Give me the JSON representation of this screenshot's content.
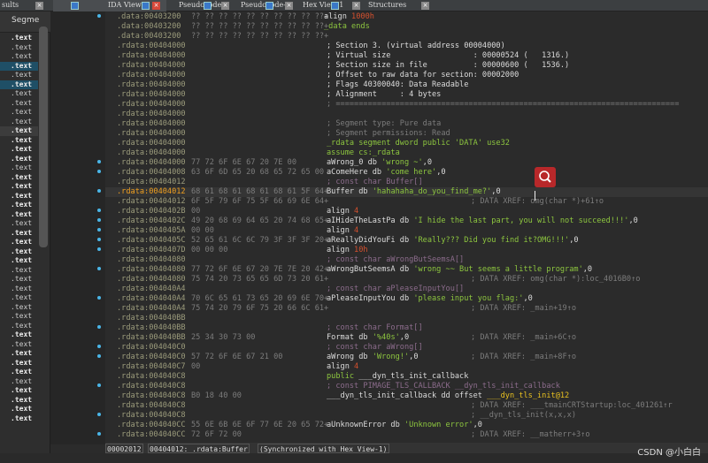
{
  "tabs": [
    {
      "label": "sults",
      "icon": "none",
      "active": false
    },
    {
      "label": "IDA View-A",
      "icon": "disassembly-icon",
      "active": true
    },
    {
      "label": "Pseudocode-B",
      "icon": "pseudocode-icon",
      "active": false
    },
    {
      "label": "Pseudocode-A",
      "icon": "pseudocode-icon",
      "active": false
    },
    {
      "label": "Hex View-1",
      "icon": "hex-icon",
      "active": false
    },
    {
      "label": "Structures",
      "icon": "structures-icon",
      "active": false
    }
  ],
  "segments_panel": {
    "header": "Segme",
    "rows": [
      {
        "t": ".text",
        "b": 1
      },
      {
        "t": ".text"
      },
      {
        "t": ".text"
      },
      {
        "t": ".text",
        "b": 1,
        "hl": 1
      },
      {
        "t": ".text"
      },
      {
        "t": ".text",
        "b": 1,
        "hl": 1
      },
      {
        "t": ".text"
      },
      {
        "t": ".text"
      },
      {
        "t": ".text"
      },
      {
        "t": ".text"
      },
      {
        "t": ".text",
        "b": 1,
        "gr": 1
      },
      {
        "t": ".text",
        "b": 1
      },
      {
        "t": ".text",
        "b": 1
      },
      {
        "t": ".text",
        "b": 1
      },
      {
        "t": ".text"
      },
      {
        "t": ".text",
        "b": 1
      },
      {
        "t": ".text",
        "b": 1
      },
      {
        "t": ".text",
        "b": 1
      },
      {
        "t": ".text",
        "b": 1
      },
      {
        "t": ".text",
        "b": 1
      },
      {
        "t": ".text"
      },
      {
        "t": ".text",
        "b": 1
      },
      {
        "t": ".text",
        "b": 1
      },
      {
        "t": ".text",
        "b": 1
      },
      {
        "t": ".text",
        "b": 1
      },
      {
        "t": ".text"
      },
      {
        "t": ".text"
      },
      {
        "t": ".text"
      },
      {
        "t": ".text"
      },
      {
        "t": ".text"
      },
      {
        "t": ".text"
      },
      {
        "t": ".text"
      },
      {
        "t": ".text",
        "b": 1
      },
      {
        "t": ".text"
      },
      {
        "t": ".text",
        "b": 1
      },
      {
        "t": ".text",
        "b": 1
      },
      {
        "t": ".text",
        "b": 1
      },
      {
        "t": ".text"
      },
      {
        "t": ".text",
        "b": 1
      },
      {
        "t": ".text",
        "b": 1
      },
      {
        "t": ".text",
        "b": 1
      },
      {
        "t": ".text",
        "b": 1
      }
    ]
  },
  "listing": [
    {
      "a": ".data:00403200",
      "h": "?? ?? ?? ?? ?? ?? ?? ?? ?? ??+",
      "p": [
        [
          "align ",
          "w"
        ],
        [
          "1000h",
          "o"
        ]
      ],
      "shift": -3
    },
    {
      "a": ".data:00403200",
      "h": "?? ?? ?? ?? ?? ?? ?? ?? ?? ??+",
      "p": [
        [
          "_data ends",
          "g"
        ]
      ],
      "shift": -3
    },
    {
      "a": ".data:00403200",
      "h": "?? ?? ?? ?? ?? ?? ?? ?? ?? ??+",
      "p": []
    },
    {
      "a": ".rdata:00404000",
      "h": "",
      "p": [
        [
          "; Section 3. (virtual address 00004000)",
          "w"
        ]
      ]
    },
    {
      "a": ".rdata:00404000",
      "h": "",
      "p": [
        [
          "; Virtual size                  : 00000524 (   1316.)",
          "w"
        ]
      ]
    },
    {
      "a": ".rdata:00404000",
      "h": "",
      "p": [
        [
          "; Section size in file          : 00000600 (   1536.)",
          "w"
        ]
      ]
    },
    {
      "a": ".rdata:00404000",
      "h": "",
      "p": [
        [
          "; Offset to raw data for section: 00002000",
          "w"
        ]
      ]
    },
    {
      "a": ".rdata:00404000",
      "h": "",
      "p": [
        [
          "; Flags 40300040: Data Readable",
          "w"
        ]
      ]
    },
    {
      "a": ".rdata:00404000",
      "h": "",
      "p": [
        [
          "; Alignment     : 4 bytes",
          "w"
        ]
      ]
    },
    {
      "a": ".rdata:00404000",
      "h": "",
      "p": [
        [
          "; ===========================================================================",
          "c"
        ]
      ]
    },
    {
      "a": ".rdata:00404000",
      "h": "",
      "p": []
    },
    {
      "a": ".rdata:00404000",
      "h": "",
      "p": [
        [
          "; Segment type: Pure data",
          "c"
        ]
      ]
    },
    {
      "a": ".rdata:00404000",
      "h": "",
      "p": [
        [
          "; Segment permissions: Read",
          "c"
        ]
      ]
    },
    {
      "a": ".rdata:00404000",
      "h": "",
      "p": [
        [
          "_rdata segment dword public 'DATA' use32",
          "g"
        ]
      ]
    },
    {
      "a": ".rdata:00404000",
      "h": "",
      "p": [
        [
          "assume cs:_rdata",
          "g"
        ]
      ]
    },
    {
      "a": ".rdata:00404000",
      "h": "77 72 6F 6E 67 20 7E 00",
      "p": [
        [
          "aWrong_0 db ",
          "w"
        ],
        [
          "'wrong ~'",
          "g"
        ],
        [
          ",0",
          "w"
        ]
      ]
    },
    {
      "a": ".rdata:00404008",
      "h": "63 6F 6D 65 20 68 65 72 65 00",
      "p": [
        [
          "aComeHere db ",
          "w"
        ],
        [
          "'come here'",
          "g"
        ],
        [
          ",0",
          "w"
        ]
      ]
    },
    {
      "a": ".rdata:00404012",
      "h": "",
      "p": [
        [
          "; const char Buffer[]",
          "p"
        ]
      ]
    },
    {
      "a": ".rdata:00404012",
      "h": "68 61 68 61 68 61 68 61 5F 64+",
      "p": [
        [
          "Buffer db ",
          "w"
        ],
        [
          "'hahahaha_do_you_find_me?'",
          "g"
        ],
        [
          ",0",
          "w"
        ]
      ],
      "cur": true
    },
    {
      "a": ".rdata:00404012",
      "h": "6F 5F 79 6F 75 5F 66 69 6E 64+",
      "p": [],
      "x": "; DATA XREF: omg(char *)+61↑o"
    },
    {
      "a": ".rdata:0040402B",
      "h": "00",
      "p": [
        [
          "align ",
          "w"
        ],
        [
          "4",
          "o"
        ]
      ]
    },
    {
      "a": ".rdata:0040402C",
      "h": "49 20 68 69 64 65 20 74 68 65+",
      "p": [
        [
          "aIHideTheLastPa db ",
          "w"
        ],
        [
          "'I hide the last part, you will not succeed!!!'",
          "g"
        ],
        [
          ",0",
          "w"
        ]
      ]
    },
    {
      "a": ".rdata:0040405A",
      "h": "00 00",
      "p": [
        [
          "align ",
          "w"
        ],
        [
          "4",
          "o"
        ]
      ]
    },
    {
      "a": ".rdata:0040405C",
      "h": "52 65 61 6C 6C 79 3F 3F 3F 20+",
      "p": [
        [
          "aReallyDidYouFi db ",
          "w"
        ],
        [
          "'Really??? Did you find it?OMG!!!'",
          "g"
        ],
        [
          ",0",
          "w"
        ]
      ]
    },
    {
      "a": ".rdata:0040407D",
      "h": "00 00 00",
      "p": [
        [
          "align ",
          "w"
        ],
        [
          "10h",
          "o"
        ]
      ]
    },
    {
      "a": ".rdata:00404080",
      "h": "",
      "p": [
        [
          "; const char aWrongButSeemsA[]",
          "p"
        ]
      ]
    },
    {
      "a": ".rdata:00404080",
      "h": "77 72 6F 6E 67 20 7E 7E 20 42+",
      "p": [
        [
          "aWrongButSeemsA db ",
          "w"
        ],
        [
          "'wrong ~~ But seems a little program'",
          "g"
        ],
        [
          ",0",
          "w"
        ]
      ]
    },
    {
      "a": ".rdata:00404080",
      "h": "75 74 20 73 65 65 6D 73 20 61+",
      "p": [],
      "x": "; DATA XREF: omg(char *):loc_4016B0↑o"
    },
    {
      "a": ".rdata:004040A4",
      "h": "",
      "p": [
        [
          "; const char aPleaseInputYou[]",
          "p"
        ]
      ]
    },
    {
      "a": ".rdata:004040A4",
      "h": "70 6C 65 61 73 65 20 69 6E 70+",
      "p": [
        [
          "aPleaseInputYou db ",
          "w"
        ],
        [
          "'please input you flag:'",
          "g"
        ],
        [
          ",0",
          "w"
        ]
      ]
    },
    {
      "a": ".rdata:004040A4",
      "h": "75 74 20 79 6F 75 20 66 6C 61+",
      "p": [],
      "x": "; DATA XREF: _main+19↑o"
    },
    {
      "a": ".rdata:004040BB",
      "h": "",
      "p": []
    },
    {
      "a": ".rdata:004040BB",
      "h": "",
      "p": [
        [
          "; const char Format[]",
          "p"
        ]
      ]
    },
    {
      "a": ".rdata:004040BB",
      "h": "25 34 30 73 00",
      "p": [
        [
          "Format db ",
          "w"
        ],
        [
          "'%40s'",
          "g"
        ],
        [
          ",0",
          "w"
        ]
      ],
      "x": "; DATA XREF: _main+6C↑o"
    },
    {
      "a": ".rdata:004040C0",
      "h": "",
      "p": [
        [
          "; const char aWrong[]",
          "p"
        ]
      ]
    },
    {
      "a": ".rdata:004040C0",
      "h": "57 72 6F 6E 67 21 00",
      "p": [
        [
          "aWrong db ",
          "w"
        ],
        [
          "'Wrong!'",
          "g"
        ],
        [
          ",0",
          "w"
        ]
      ],
      "x": "; DATA XREF: _main+8F↑o"
    },
    {
      "a": ".rdata:004040C7",
      "h": "00",
      "p": [
        [
          "align ",
          "w"
        ],
        [
          "4",
          "o"
        ]
      ]
    },
    {
      "a": ".rdata:004040C8",
      "h": "",
      "p": [
        [
          "public ",
          "g"
        ],
        [
          "___dyn_tls_init_callback",
          "w"
        ]
      ]
    },
    {
      "a": ".rdata:004040C8",
      "h": "",
      "p": [
        [
          "; const PIMAGE_TLS_CALLBACK __dyn_tls_init_callback",
          "p"
        ]
      ]
    },
    {
      "a": ".rdata:004040C8",
      "h": "B0 18 40 00",
      "p": [
        [
          "___dyn_tls_init_callback dd offset ",
          "w"
        ],
        [
          "___dyn_tls_init@12",
          "y"
        ]
      ]
    },
    {
      "a": ".rdata:004040C8",
      "h": "",
      "p": [],
      "x": "; DATA XREF: ___tmainCRTStartup:loc_401261↑r"
    },
    {
      "a": ".rdata:004040C8",
      "h": "",
      "p": [],
      "x": "; __dyn_tls_init(x,x,x)"
    },
    {
      "a": ".rdata:004040CC",
      "h": "55 6E 6B 6E 6F 77 6E 20 65 72+",
      "p": [
        [
          "aUnknownError db ",
          "w"
        ],
        [
          "'Unknown error'",
          "g"
        ],
        [
          ",0",
          "w"
        ]
      ]
    },
    {
      "a": ".rdata:004040CC",
      "h": "72 6F 72 00",
      "p": [],
      "x": "; DATA XREF: __matherr+3↑o"
    }
  ],
  "status": {
    "offset": "00002012",
    "location": "00404012: .rdata:Buffer",
    "sync": "(Synchronized with Hex View-1)"
  },
  "watermark": "CSDN @小白白",
  "colors": {
    "background": "#2b2b2b",
    "string": "#8dc63f",
    "number": "#d4502e",
    "current_address": "#f0a020",
    "search_button": "#b8282a"
  }
}
